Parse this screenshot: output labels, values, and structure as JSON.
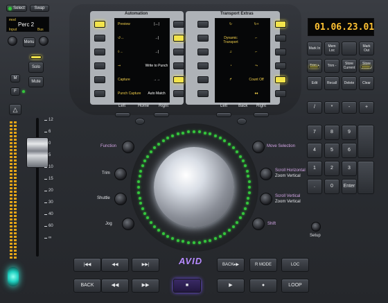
{
  "top_left": {
    "select": "Select",
    "swap": "Swap",
    "channel_label": "mod",
    "channel_name": "Perc 2",
    "input": "Input",
    "bus": "Bus",
    "menu": "Menu",
    "solo": "Solo",
    "mute": "Mute",
    "m": "M",
    "f": "F"
  },
  "fader_scale": [
    "12",
    "6",
    "0",
    "5",
    "10",
    "15",
    "20",
    "30",
    "40",
    "60",
    "∞"
  ],
  "automation": {
    "header": "Automation",
    "rows": [
      {
        "left": "Preview",
        "right": "|↔|"
      },
      {
        "left": "↺↔",
        "right": "→|"
      },
      {
        "left": "◊→",
        "right": "→|"
      },
      {
        "left": "⇝",
        "right": "Write to Punch"
      },
      {
        "left": "Capture",
        "right": "→→"
      },
      {
        "left": "Punch Capture",
        "right": "Auto Match"
      }
    ],
    "footer": {
      "left": "Left",
      "home": "Home",
      "right": "Right"
    }
  },
  "transport": {
    "header": "Transport Extras",
    "rows": [
      {
        "left": "↻",
        "right": "↻+"
      },
      {
        "left": "Dynamic Transport",
        "right": "⌐"
      },
      {
        "left": "♫",
        "right": "⌐"
      },
      {
        "left": "◔",
        "right": "⤳"
      },
      {
        "left": "↱",
        "right": "Count Off"
      },
      {
        "left": "",
        "right": "♦♦"
      }
    ],
    "footer": {
      "left": "Left",
      "back": "Back",
      "right": "Right"
    }
  },
  "counter": "01.06.23.01",
  "right_keys": [
    [
      "Mark In",
      "Mem Loc",
      "",
      "Mark Out"
    ],
    [
      "Trim +",
      "Trim -",
      "Store Current",
      "Store Locate"
    ],
    [
      "Edit",
      "Recall",
      "Delete",
      "Clear"
    ]
  ],
  "numpad": [
    [
      "/",
      "*",
      "-",
      "+"
    ],
    [
      "7",
      "8",
      "9",
      ""
    ],
    [
      "4",
      "5",
      "6",
      ""
    ],
    [
      "1",
      "2",
      "3",
      ""
    ],
    [
      ".",
      "0",
      "Enter",
      ""
    ]
  ],
  "setup": "Setup",
  "left_labels": {
    "function": "Function",
    "trim": "Trim",
    "shuttle": "Shuttle",
    "jog": "Jog"
  },
  "right_labels": {
    "move": "Move Selection",
    "scroll_h": "Scroll Horizontal",
    "zoom_v": "Zoom Vertical",
    "scroll_v": "Scroll Vertical",
    "zoom_v2": "Zoom Vertical",
    "shift": "Shift"
  },
  "logo": "AVID",
  "transport_row1": [
    "|◀◀",
    "◀◀",
    "▶▶|",
    "",
    "BACK▸▶",
    "R MODE",
    "LOC"
  ],
  "transport_row2": [
    "BACK",
    "◀◀",
    "▶▶",
    "■",
    "▶",
    "●",
    "LOOP"
  ]
}
